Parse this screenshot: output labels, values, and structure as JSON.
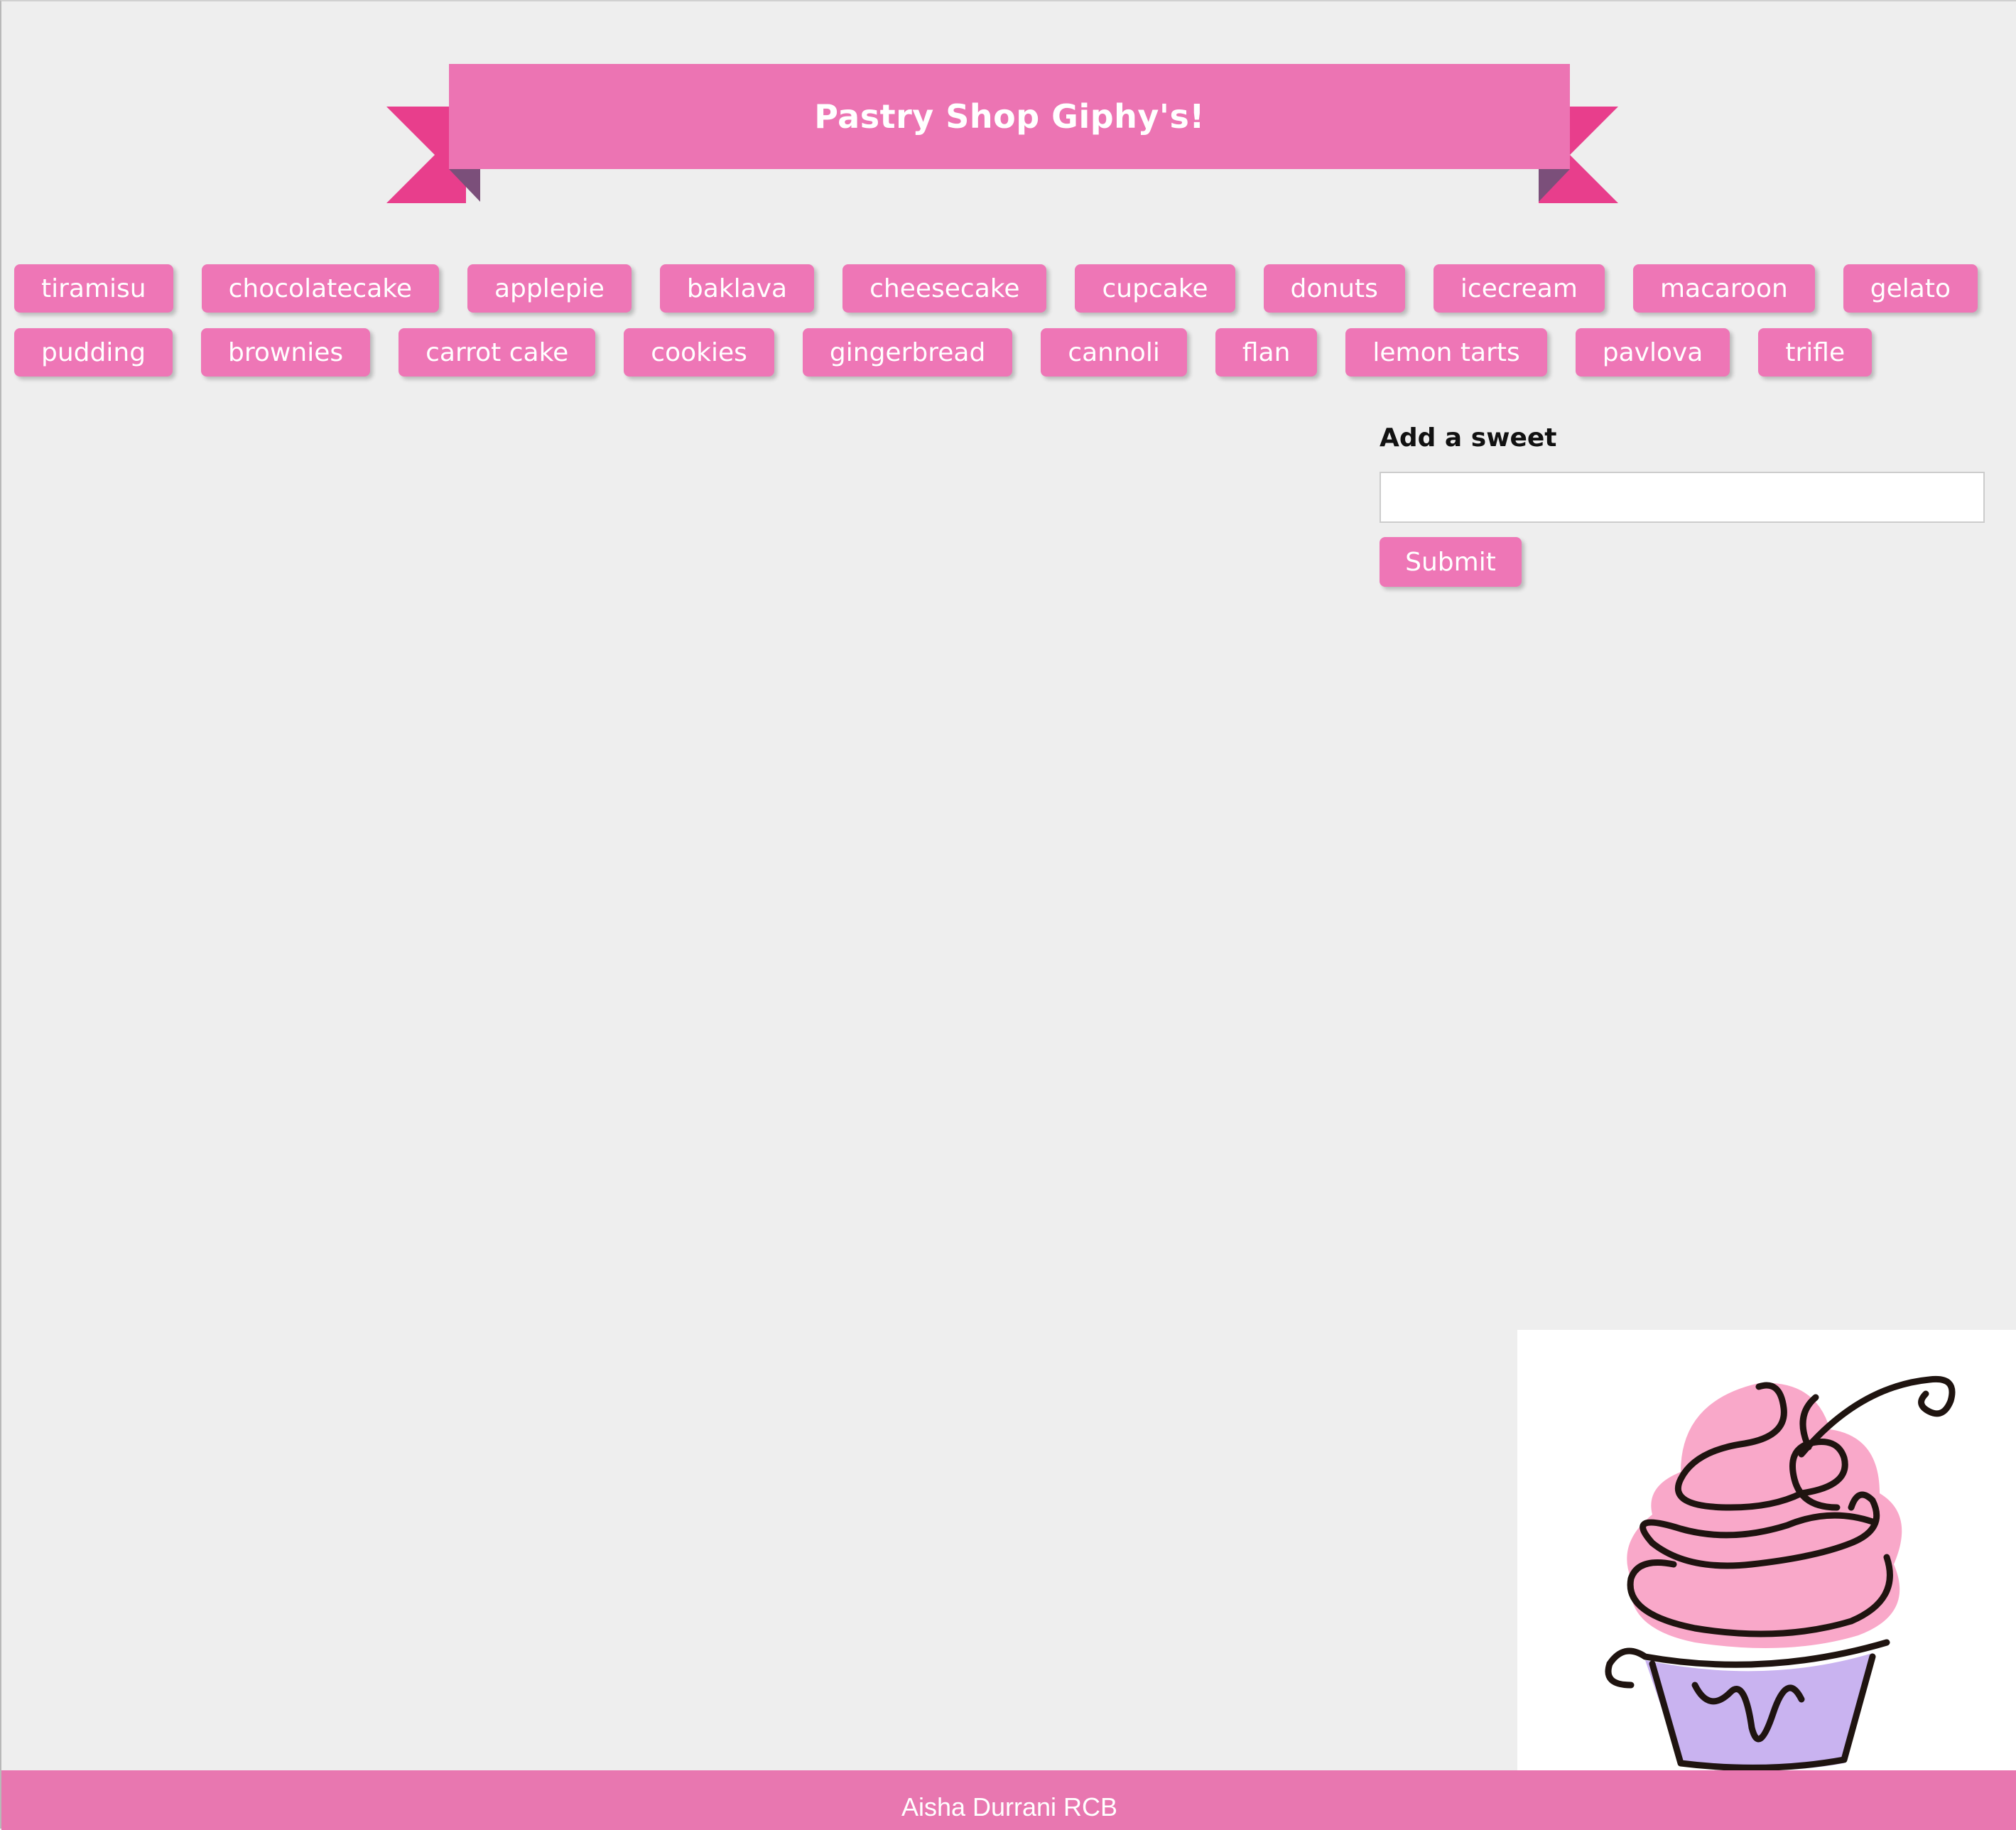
{
  "header": {
    "title": "Pastry Shop Giphy's!"
  },
  "buttons": {
    "row1": [
      "tiramisu",
      "chocolatecake",
      "applepie",
      "baklava",
      "cheesecake",
      "cupcake",
      "donuts",
      "icecream",
      "macaroon",
      "gelato"
    ],
    "row2": [
      "pudding",
      "brownies",
      "carrot cake",
      "cookies",
      "gingerbread",
      "cannoli",
      "flan",
      "lemon tarts",
      "pavlova",
      "trifle"
    ]
  },
  "form": {
    "label": "Add a sweet",
    "input_value": "",
    "submit_label": "Submit"
  },
  "image": {
    "icon": "cupcake-illustration"
  },
  "footer": {
    "text": "Aisha Durrani RCB"
  },
  "colors": {
    "ribbon": "#ec74b3",
    "ribbon_ends": "#e83e8c",
    "ribbon_fold": "#7b4f7a",
    "button": "#ee76b6",
    "footer": "#e877b0",
    "background": "#eeeeee",
    "frosting": "#f9a8c9",
    "liner": "#c9b3f0"
  }
}
